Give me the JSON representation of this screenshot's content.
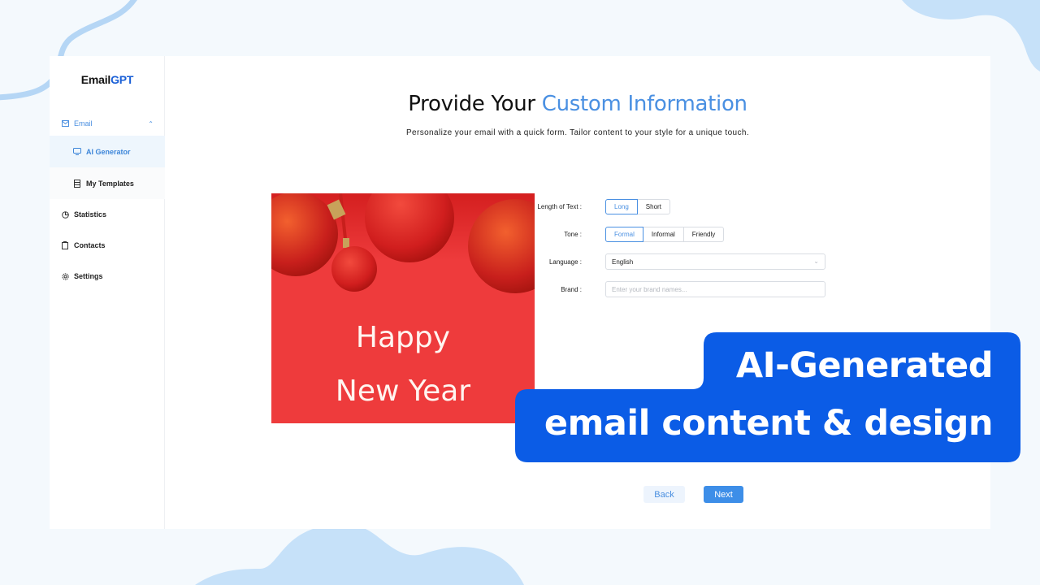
{
  "app": {
    "logo_prefix": "Email",
    "logo_suffix": "GPT"
  },
  "sidebar": {
    "parent": {
      "label": "Email",
      "icon": "mail-icon",
      "expanded": true
    },
    "sub_items": [
      {
        "label": "AI Generator",
        "icon": "monitor-icon",
        "active": true
      },
      {
        "label": "My Templates",
        "icon": "document-icon",
        "active": false
      }
    ],
    "items": [
      {
        "label": "Statistics",
        "icon": "pie-chart-icon"
      },
      {
        "label": "Contacts",
        "icon": "contacts-icon"
      },
      {
        "label": "Settings",
        "icon": "gear-icon"
      }
    ]
  },
  "main": {
    "title_plain": "Provide Your",
    "title_accent": "Custom Information",
    "subtitle": "Personalize your email with a quick form. Tailor content to your style for a unique touch.",
    "preview": {
      "line1": "Happy",
      "line2": "New Year"
    },
    "form": {
      "length": {
        "label": "Length of Text",
        "options": [
          "Long",
          "Short"
        ],
        "selected": "Long"
      },
      "tone": {
        "label": "Tone",
        "options": [
          "Formal",
          "Informal",
          "Friendly"
        ],
        "selected": "Formal"
      },
      "language": {
        "label": "Language",
        "value": "English"
      },
      "brand": {
        "label": "Brand",
        "value": "",
        "placeholder": "Enter your brand names..."
      }
    },
    "buttons": {
      "back": "Back",
      "next": "Next"
    }
  },
  "banner": {
    "line1": "AI-Generated",
    "line2": "email content & design",
    "color": "#0b5ce6"
  },
  "colors": {
    "accent": "#4a90e2",
    "background": "#f4f9fd",
    "blob": "#c6e1f9",
    "card_red": "#ee3b3c"
  }
}
